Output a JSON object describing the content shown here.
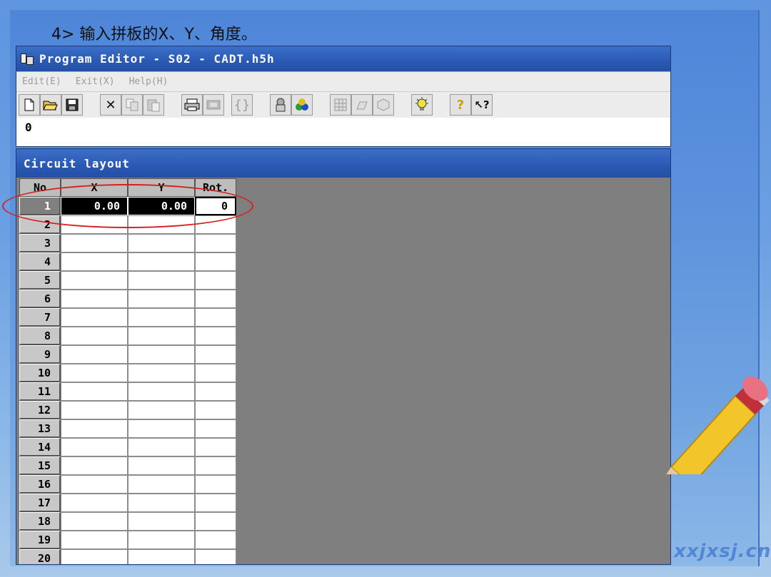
{
  "slide": {
    "caption": "4> 输入拼板的X、Y、角度。",
    "watermark": "xxjxsj.cn"
  },
  "editor": {
    "title": "Program Editor - S02 - CADT.h5h",
    "menu": [
      "Edit(E)",
      "Exit(X)",
      "Help(H)"
    ],
    "toolbar_icons": [
      "new-file-icon",
      "open-folder-icon",
      "save-icon",
      "cut-icon",
      "copy-icon",
      "paste-icon",
      "print-icon",
      "preview-icon",
      "bracket-icon",
      "tool-icon",
      "components-icon",
      "grid-icon",
      "machine-icon",
      "package-icon",
      "lightbulb-icon",
      "help-icon",
      "context-help-icon"
    ],
    "value_line": "0"
  },
  "circuit": {
    "title": "Circuit layout",
    "columns": [
      "No",
      "X",
      "Y",
      "Rot."
    ],
    "rows": [
      {
        "no": "1",
        "x": "0.00",
        "y": "0.00",
        "rot": "0"
      },
      {
        "no": "2",
        "x": "",
        "y": "",
        "rot": ""
      },
      {
        "no": "3",
        "x": "",
        "y": "",
        "rot": ""
      },
      {
        "no": "4",
        "x": "",
        "y": "",
        "rot": ""
      },
      {
        "no": "5",
        "x": "",
        "y": "",
        "rot": ""
      },
      {
        "no": "6",
        "x": "",
        "y": "",
        "rot": ""
      },
      {
        "no": "7",
        "x": "",
        "y": "",
        "rot": ""
      },
      {
        "no": "8",
        "x": "",
        "y": "",
        "rot": ""
      },
      {
        "no": "9",
        "x": "",
        "y": "",
        "rot": ""
      },
      {
        "no": "10",
        "x": "",
        "y": "",
        "rot": ""
      },
      {
        "no": "11",
        "x": "",
        "y": "",
        "rot": ""
      },
      {
        "no": "12",
        "x": "",
        "y": "",
        "rot": ""
      },
      {
        "no": "13",
        "x": "",
        "y": "",
        "rot": ""
      },
      {
        "no": "14",
        "x": "",
        "y": "",
        "rot": ""
      },
      {
        "no": "15",
        "x": "",
        "y": "",
        "rot": ""
      },
      {
        "no": "16",
        "x": "",
        "y": "",
        "rot": ""
      },
      {
        "no": "17",
        "x": "",
        "y": "",
        "rot": ""
      },
      {
        "no": "18",
        "x": "",
        "y": "",
        "rot": ""
      },
      {
        "no": "19",
        "x": "",
        "y": "",
        "rot": ""
      },
      {
        "no": "20",
        "x": "",
        "y": "",
        "rot": ""
      }
    ]
  },
  "colors": {
    "titlebar": "#2a59b4",
    "highlight": "#d42020",
    "grid_background": "#7f7f7f"
  }
}
